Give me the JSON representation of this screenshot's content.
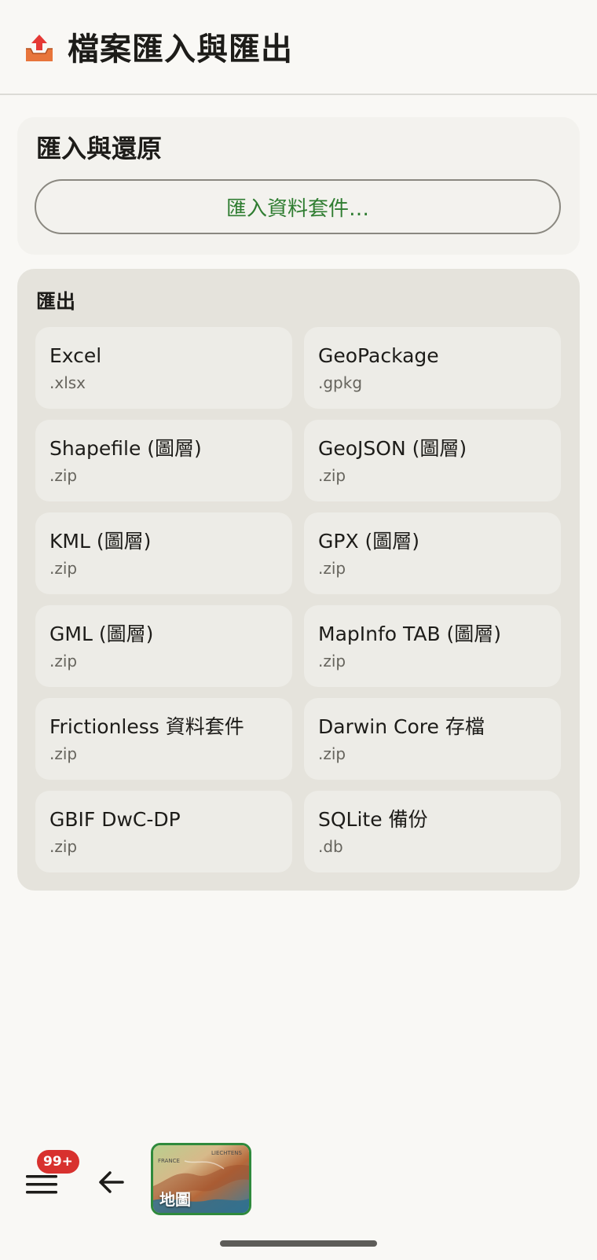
{
  "header": {
    "icon": "outbox-tray-icon",
    "title": "檔案匯入與匯出"
  },
  "import_section": {
    "title": "匯入與還原",
    "button_label": "匯入資料套件…"
  },
  "export_section": {
    "title": "匯出",
    "formats": [
      {
        "name": "Excel",
        "ext": ".xlsx"
      },
      {
        "name": "GeoPackage",
        "ext": ".gpkg"
      },
      {
        "name": "Shapefile (圖層)",
        "ext": ".zip"
      },
      {
        "name": "GeoJSON (圖層)",
        "ext": ".zip"
      },
      {
        "name": "KML (圖層)",
        "ext": ".zip"
      },
      {
        "name": "GPX (圖層)",
        "ext": ".zip"
      },
      {
        "name": "GML (圖層)",
        "ext": ".zip"
      },
      {
        "name": "MapInfo TAB (圖層)",
        "ext": ".zip"
      },
      {
        "name": "Frictionless 資料套件",
        "ext": ".zip"
      },
      {
        "name": "Darwin Core 存檔",
        "ext": ".zip"
      },
      {
        "name": "GBIF DwC-DP",
        "ext": ".zip"
      },
      {
        "name": "SQLite 備份",
        "ext": ".db"
      }
    ]
  },
  "bottom_bar": {
    "menu_icon": "hamburger-menu-icon",
    "badge": "99+",
    "back_icon": "arrow-left-icon",
    "map_label": "地圖",
    "map_tiny_labels": [
      "FRANCE",
      "LIECHTENS"
    ]
  },
  "colors": {
    "background": "#f9f8f5",
    "accent_green": "#2f7d31",
    "badge_red": "#d8312e",
    "export_card": "#e5e3dc"
  }
}
